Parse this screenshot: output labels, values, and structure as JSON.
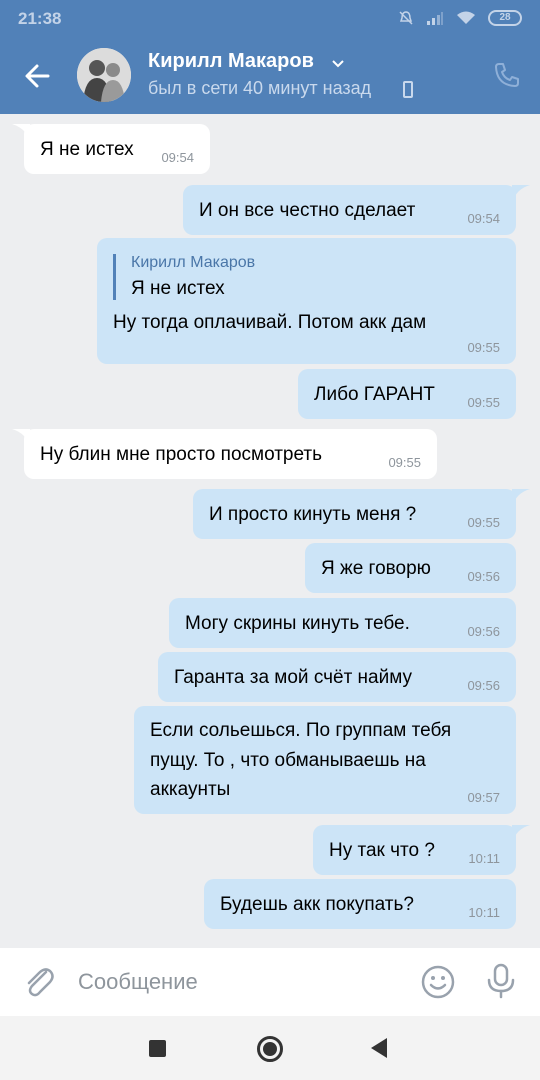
{
  "status_bar": {
    "time": "21:38",
    "battery": "28"
  },
  "header": {
    "contact_name": "Кирилл Макаров",
    "contact_status": "был в сети 40 минут назад"
  },
  "messages": [
    {
      "direction": "in",
      "text": "Я не истех",
      "time": "09:54"
    },
    {
      "direction": "out",
      "text": "И он все честно сделает",
      "time": "09:54"
    },
    {
      "direction": "out",
      "reply_to": {
        "author": "Кирилл Макаров",
        "text": "Я не истех"
      },
      "text": "Ну тогда оплачивай. Потом акк дам",
      "time": "09:55"
    },
    {
      "direction": "out",
      "text": "Либо ГАРАНТ",
      "time": "09:55"
    },
    {
      "direction": "in",
      "text": "Ну блин мне просто посмотреть",
      "time": "09:55"
    },
    {
      "direction": "out",
      "text": "И просто кинуть меня ?",
      "time": "09:55"
    },
    {
      "direction": "out",
      "text": "Я же говорю",
      "time": "09:56"
    },
    {
      "direction": "out",
      "text": "Могу скрины кинуть тебе.",
      "time": "09:56"
    },
    {
      "direction": "out",
      "text": "Гаранта за мой счёт найму",
      "time": "09:56"
    },
    {
      "direction": "out",
      "lines": [
        "Если сольешься. По группам тебя",
        "пущу. То , что обманываешь на",
        "аккаунты"
      ],
      "time": "09:57"
    },
    {
      "direction": "out",
      "text": "Ну так что ?",
      "time": "10:11"
    },
    {
      "direction": "out",
      "text": "Будешь акк покупать?",
      "time": "10:11"
    }
  ],
  "composer": {
    "placeholder": "Сообщение"
  },
  "colors": {
    "header": "#5181b8",
    "outgoing_bubble": "#cce4f7",
    "incoming_bubble": "#ffffff",
    "background": "#edeef0"
  }
}
